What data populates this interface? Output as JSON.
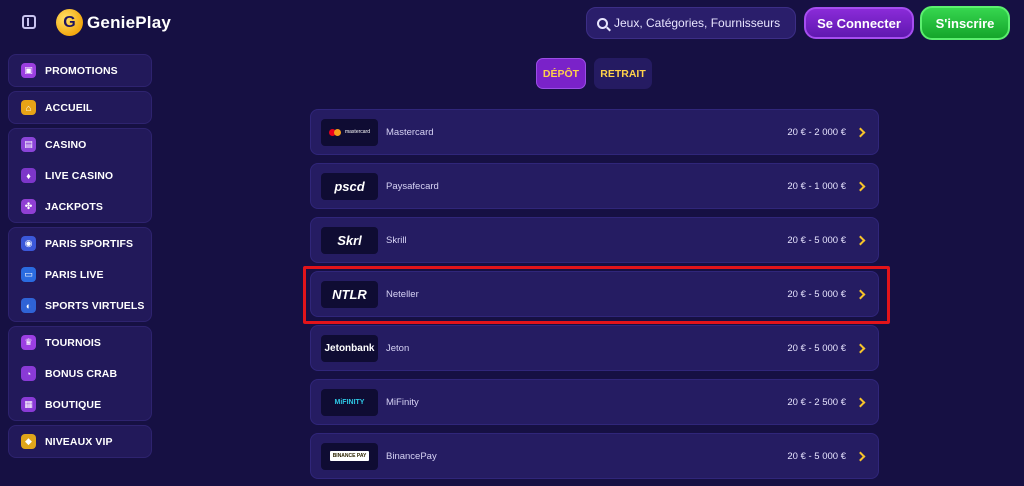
{
  "header": {
    "logo_text": "GeniePlay",
    "logo_mark": "G",
    "search_placeholder": "Jeux, Catégories, Fournisseurs",
    "login_label": "Se Connecter",
    "signup_label": "S'inscrire"
  },
  "sidebar": {
    "groups": [
      [
        {
          "label": "PROMOTIONS",
          "icon": "gift-icon",
          "color": "#9b3fe0",
          "glyph": "▣"
        }
      ],
      [
        {
          "label": "ACCUEIL",
          "icon": "home-icon",
          "color": "#e8a316",
          "glyph": "⌂"
        }
      ],
      [
        {
          "label": "CASINO",
          "icon": "slot-machine-icon",
          "color": "#8b44d8",
          "glyph": "▤"
        },
        {
          "label": "LIVE CASINO",
          "icon": "cards-icon",
          "color": "#7d36c9",
          "glyph": "♦"
        },
        {
          "label": "JACKPOTS",
          "icon": "clover-icon",
          "color": "#8f3fd3",
          "glyph": "✤"
        }
      ],
      [
        {
          "label": "PARIS SPORTIFS",
          "icon": "ball-icon",
          "color": "#3b58d9",
          "glyph": "◉"
        },
        {
          "label": "PARIS LIVE",
          "icon": "live-icon",
          "color": "#2a6be0",
          "glyph": "▭"
        },
        {
          "label": "SPORTS VIRTUELS",
          "icon": "virtual-sports-icon",
          "color": "#2f63d6",
          "glyph": "◐"
        }
      ],
      [
        {
          "label": "TOURNOIS",
          "icon": "trophy-icon",
          "color": "#9c3fe3",
          "glyph": "♛"
        },
        {
          "label": "BONUS CRAB",
          "icon": "claw-icon",
          "color": "#8a3ad6",
          "glyph": "◔"
        },
        {
          "label": "BOUTIQUE",
          "icon": "shop-icon",
          "color": "#8a3ad6",
          "glyph": "▦"
        }
      ],
      [
        {
          "label": "NIVEAUX VIP",
          "icon": "diamond-icon",
          "color": "#e0a51a",
          "glyph": "◆"
        }
      ]
    ]
  },
  "tabs": {
    "deposit": "DÉPÔT",
    "withdraw": "RETRAIT"
  },
  "payments": [
    {
      "name": "Mastercard",
      "range": "20 € - 2 000 €",
      "logo_text": "mastercard",
      "logo": "mastercard-logo"
    },
    {
      "name": "Paysafecard",
      "range": "20 € - 1 000 €",
      "logo_text": "pscd",
      "logo": "paysafecard-logo"
    },
    {
      "name": "Skrill",
      "range": "20 € - 5 000 €",
      "logo_text": "Skrl",
      "logo": "skrill-logo"
    },
    {
      "name": "Neteller",
      "range": "20 € - 5 000 €",
      "logo_text": "NTLR",
      "logo": "neteller-logo"
    },
    {
      "name": "Jeton",
      "range": "20 € - 5 000 €",
      "logo_text": "Jetonbank",
      "logo": "jeton-logo"
    },
    {
      "name": "MiFinity",
      "range": "20 € - 2 500 €",
      "logo_text": "MiFINITY",
      "logo": "mifinity-logo"
    },
    {
      "name": "BinancePay",
      "range": "20 € - 5 000 €",
      "logo_text": "BINANCE PAY",
      "logo": "binance-logo"
    }
  ],
  "colors": {
    "background": "#161043",
    "accent_yellow": "#ffd24a",
    "highlight_red": "#e2141a"
  }
}
